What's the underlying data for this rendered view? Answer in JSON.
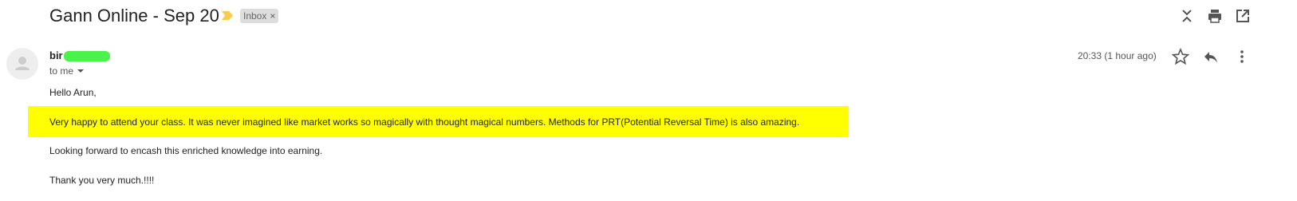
{
  "header": {
    "subject": "Gann Online - Sep 20",
    "label_chip": {
      "text": "Inbox",
      "remove": "×"
    },
    "icons": [
      "expand-collapse-icon",
      "print-icon",
      "open-in-new-window-icon"
    ]
  },
  "message": {
    "sender_name": "bir        ara",
    "recipient": "to me",
    "timestamp": "20:33 (1 hour ago)",
    "action_icons": [
      "star-icon",
      "reply-icon",
      "more-vert-icon"
    ],
    "body": {
      "greeting": "Hello Arun,",
      "highlighted": "Very happy to attend your class. It was never imagined like market works so magically with thought magical numbers. Methods for PRT(Potential Reversal Time) is also amazing.",
      "line2": "Looking forward to encash this enriched knowledge into earning.",
      "signoff": "Thank you very much.!!!!"
    }
  },
  "colors": {
    "highlight": "#ffff00",
    "importance": "#f7cb4d",
    "redaction": "#4cf24c"
  }
}
